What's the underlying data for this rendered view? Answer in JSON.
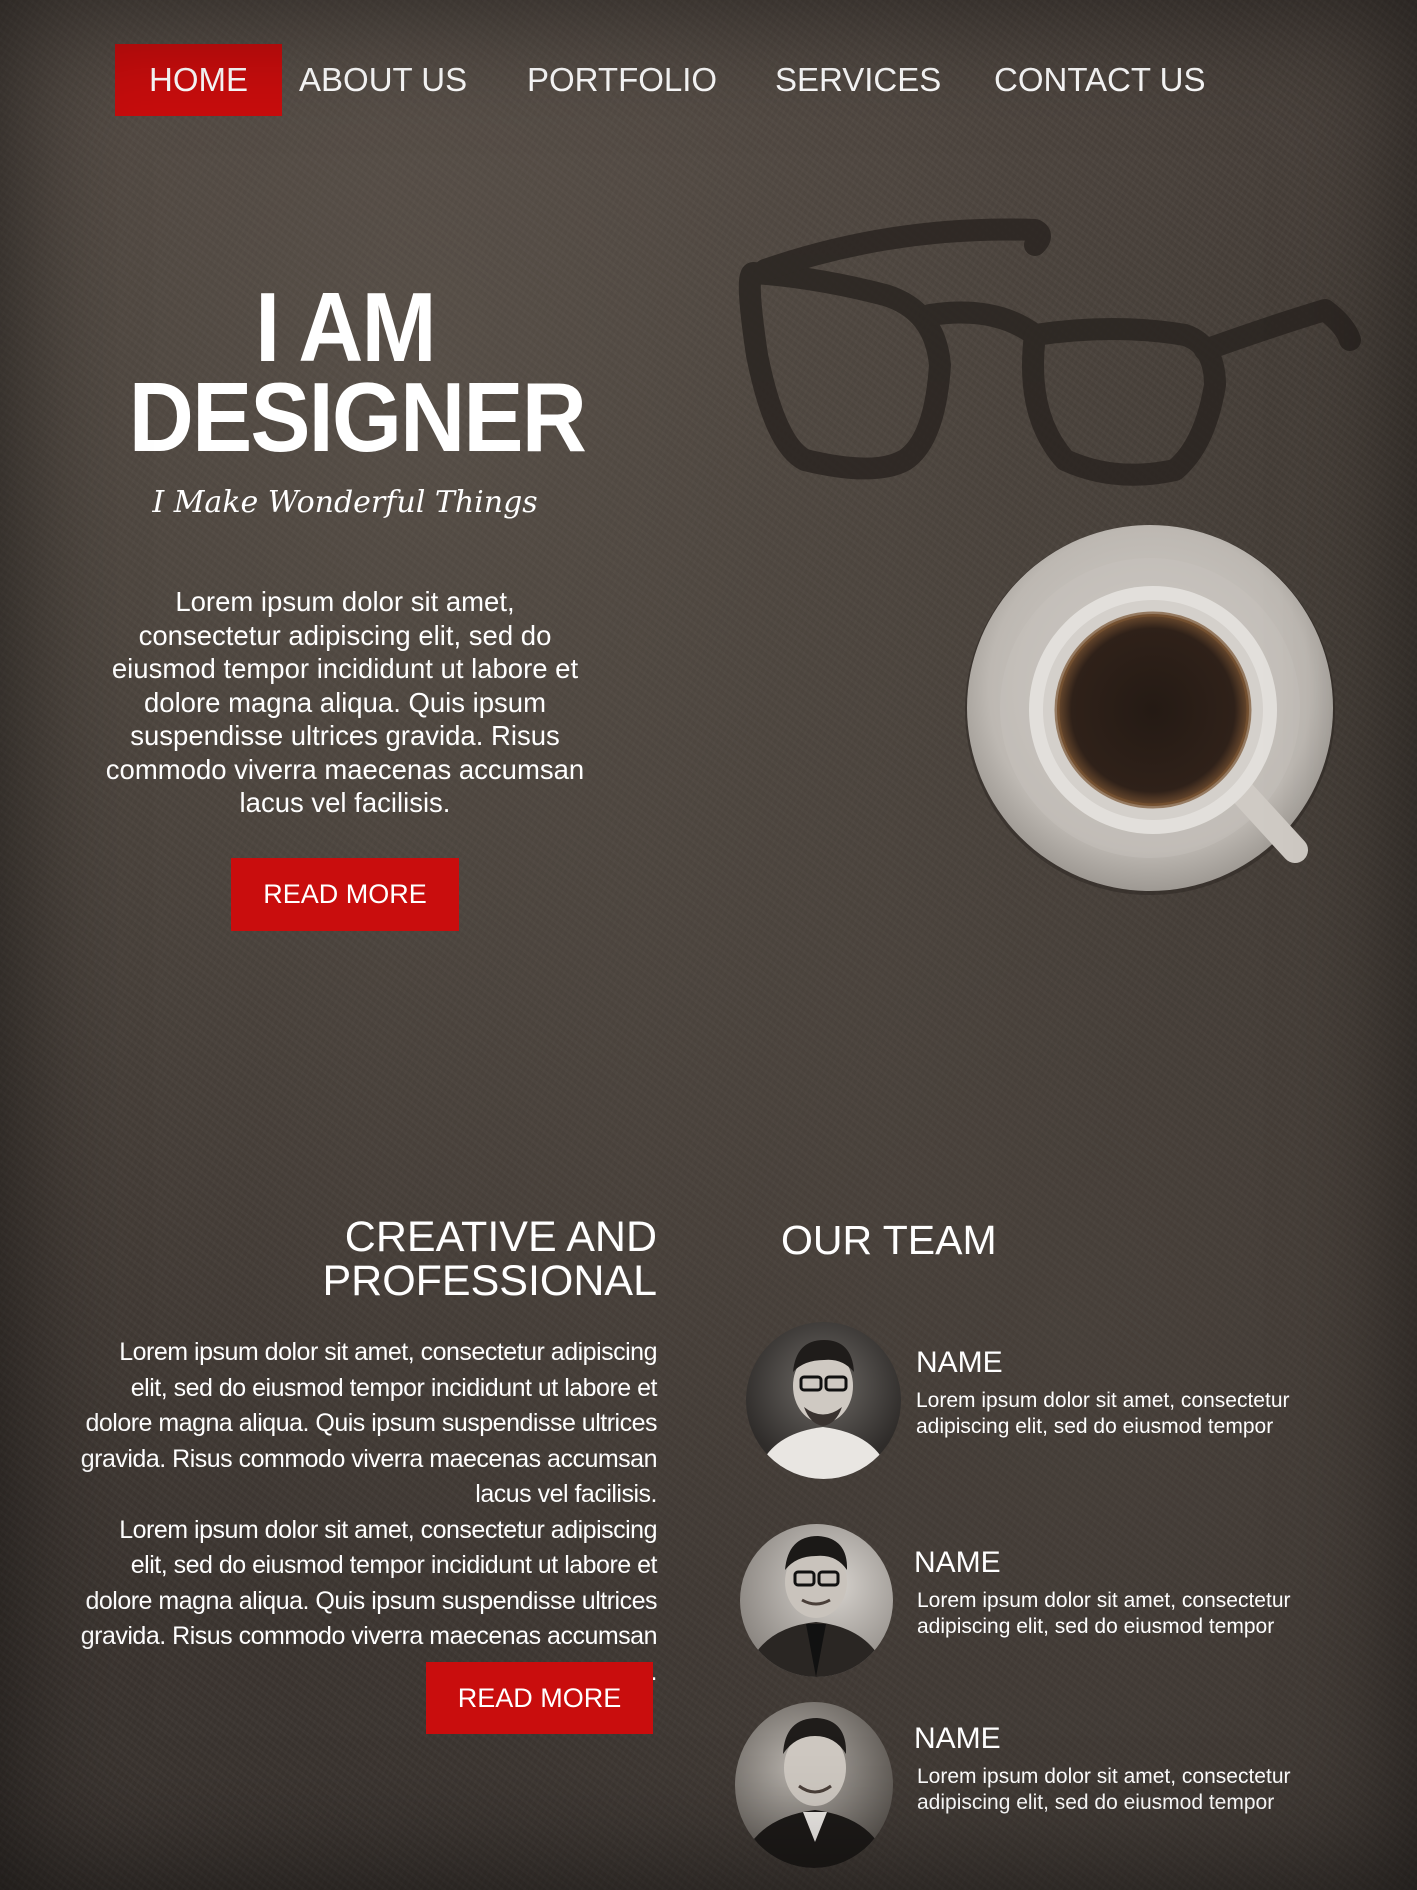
{
  "nav": {
    "items": [
      {
        "label": "HOME",
        "active": true
      },
      {
        "label": "ABOUT US"
      },
      {
        "label": "PORTFOLIO"
      },
      {
        "label": "SERVICES"
      },
      {
        "label": "CONTACT US"
      }
    ]
  },
  "hero": {
    "title_line1": "I AM",
    "title_line2": "DESIGNER",
    "subtitle": "I Make Wonderful Things",
    "text": "Lorem ipsum dolor sit amet, consectetur adipiscing elit, sed do eiusmod tempor incididunt ut labore et dolore magna aliqua. Quis ipsum suspendisse ultrices gravida. Risus commodo viverra maecenas accumsan lacus vel facilisis.",
    "button": "READ MORE"
  },
  "about": {
    "heading_line1": "CREATIVE AND",
    "heading_line2": "PROFESSIONAL",
    "paragraph1": "Lorem ipsum dolor sit amet, consectetur adipiscing elit, sed do eiusmod tempor incididunt ut labore et dolore magna aliqua. Quis ipsum suspendisse ultrices gravida. Risus commodo viverra maecenas accumsan lacus vel facilisis.",
    "paragraph2": "Lorem ipsum dolor sit amet, consectetur adipiscing elit, sed do eiusmod tempor incididunt ut labore et dolore magna aliqua. Quis ipsum suspendisse ultrices gravida. Risus commodo viverra maecenas accumsan lacus vel facilisis.",
    "button": "READ MORE"
  },
  "team": {
    "heading": "OUR TEAM",
    "members": [
      {
        "name": "NAME",
        "text": "Lorem ipsum dolor sit amet, consectetur adipiscing elit, sed do eiusmod tempor"
      },
      {
        "name": "NAME",
        "text": "Lorem ipsum dolor sit amet, consectetur adipiscing elit, sed do eiusmod tempor"
      },
      {
        "name": "NAME",
        "text": "Lorem ipsum dolor sit amet, consectetur adipiscing elit, sed do eiusmod tempor"
      }
    ]
  },
  "colors": {
    "accent": "#c90d0d",
    "background": "#433c36",
    "text": "#ffffff"
  }
}
